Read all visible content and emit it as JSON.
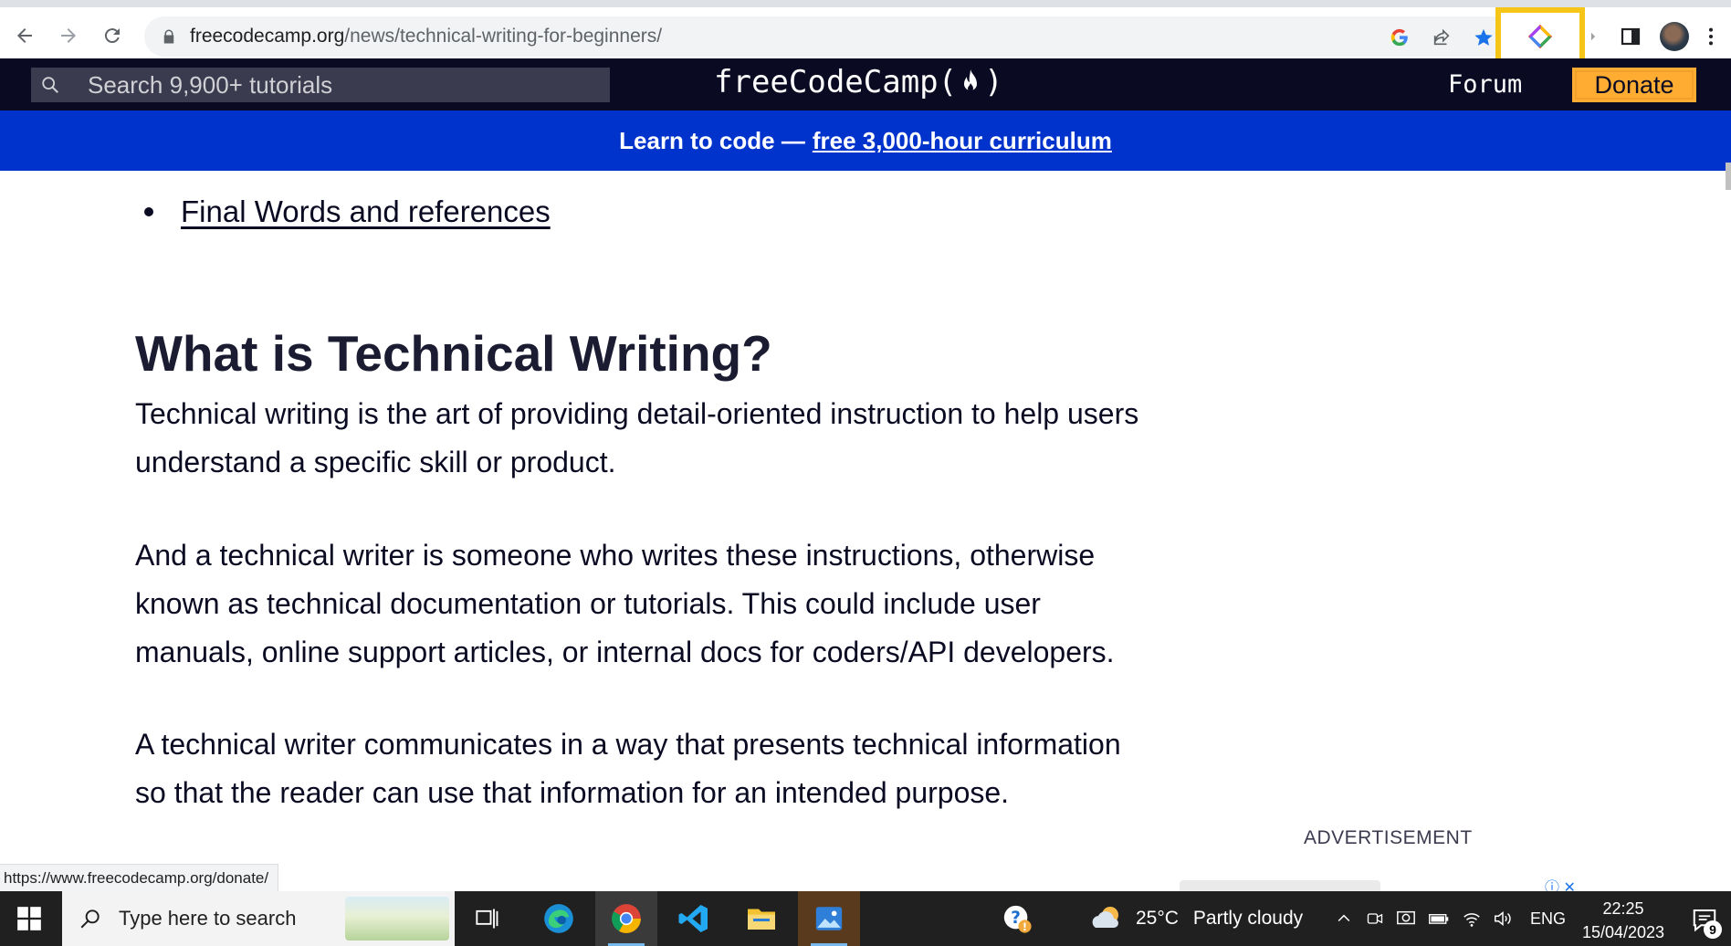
{
  "browser": {
    "url_domain": "freecodecamp.org",
    "url_path": "/news/technical-writing-for-beginners/",
    "status_url": "https://www.freecodecamp.org/donate/"
  },
  "fcc_header": {
    "search_placeholder": "Search 9,900+ tutorials",
    "logo_text_left": "freeCodeCamp(",
    "logo_text_right": ")",
    "forum_label": "Forum",
    "donate_label": "Donate"
  },
  "banner": {
    "prefix": "Learn to code —",
    "link_text": "free 3,000-hour curriculum"
  },
  "article": {
    "toc_item": "Final Words and references",
    "heading": "What is Technical Writing?",
    "paragraphs": [
      "Technical writing is the art of providing detail-oriented instruction to help users understand a specific skill or product.",
      "And a technical writer is someone who writes these instructions, otherwise known as technical documentation or tutorials. This could include user manuals, online support articles, or internal docs for coders/API developers.",
      "A technical writer communicates in a way that presents technical information so that the reader can use that information for an intended purpose."
    ],
    "ad_label": "ADVERTISEMENT"
  },
  "taskbar": {
    "search_placeholder": "Type here to search",
    "weather_temp": "25°C",
    "weather_desc": "Partly cloudy",
    "language": "ENG",
    "time": "22:25",
    "date": "15/04/2023",
    "notification_count": "9"
  },
  "colors": {
    "fcc_dark": "#0a0a23",
    "banner_blue": "#0033cc",
    "donate_yellow": "#feac32",
    "highlight_yellow": "#f5c518"
  }
}
